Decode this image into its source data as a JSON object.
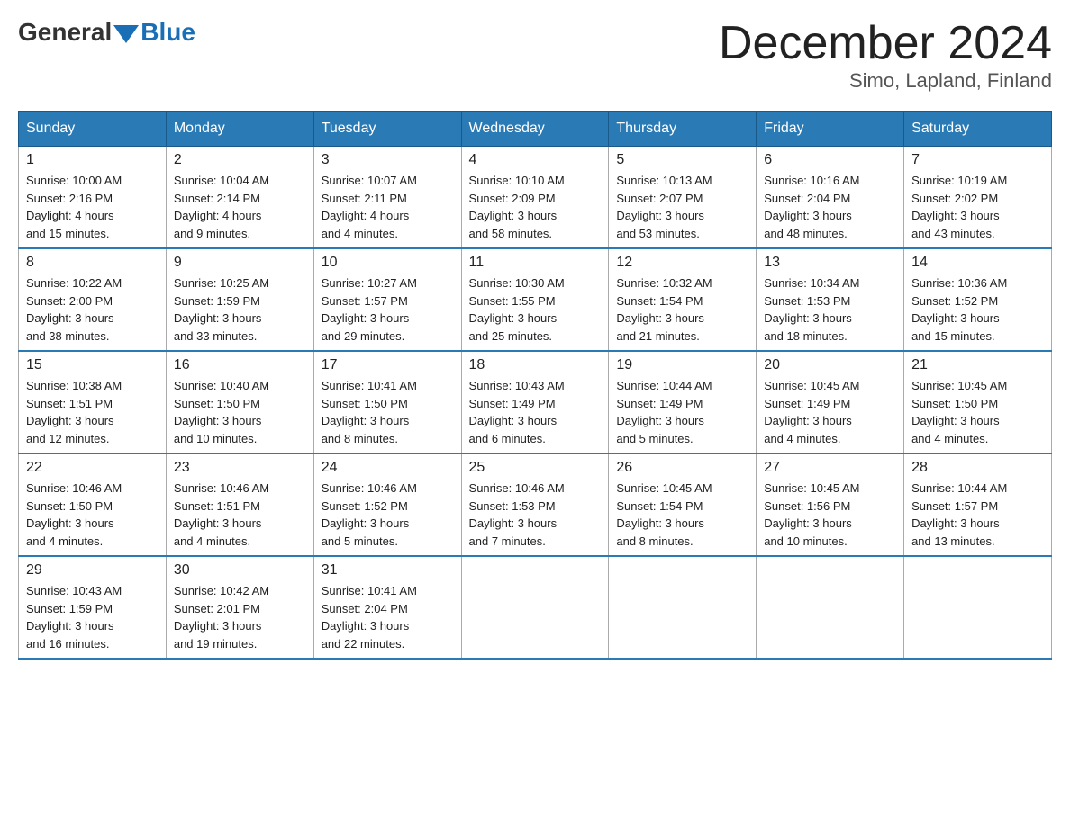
{
  "header": {
    "logo_general": "General",
    "logo_blue": "Blue",
    "month_title": "December 2024",
    "location": "Simo, Lapland, Finland"
  },
  "days_of_week": [
    "Sunday",
    "Monday",
    "Tuesday",
    "Wednesday",
    "Thursday",
    "Friday",
    "Saturday"
  ],
  "weeks": [
    [
      {
        "day": "1",
        "sunrise": "10:00 AM",
        "sunset": "2:16 PM",
        "daylight": "4 hours and 15 minutes."
      },
      {
        "day": "2",
        "sunrise": "10:04 AM",
        "sunset": "2:14 PM",
        "daylight": "4 hours and 9 minutes."
      },
      {
        "day": "3",
        "sunrise": "10:07 AM",
        "sunset": "2:11 PM",
        "daylight": "4 hours and 4 minutes."
      },
      {
        "day": "4",
        "sunrise": "10:10 AM",
        "sunset": "2:09 PM",
        "daylight": "3 hours and 58 minutes."
      },
      {
        "day": "5",
        "sunrise": "10:13 AM",
        "sunset": "2:07 PM",
        "daylight": "3 hours and 53 minutes."
      },
      {
        "day": "6",
        "sunrise": "10:16 AM",
        "sunset": "2:04 PM",
        "daylight": "3 hours and 48 minutes."
      },
      {
        "day": "7",
        "sunrise": "10:19 AM",
        "sunset": "2:02 PM",
        "daylight": "3 hours and 43 minutes."
      }
    ],
    [
      {
        "day": "8",
        "sunrise": "10:22 AM",
        "sunset": "2:00 PM",
        "daylight": "3 hours and 38 minutes."
      },
      {
        "day": "9",
        "sunrise": "10:25 AM",
        "sunset": "1:59 PM",
        "daylight": "3 hours and 33 minutes."
      },
      {
        "day": "10",
        "sunrise": "10:27 AM",
        "sunset": "1:57 PM",
        "daylight": "3 hours and 29 minutes."
      },
      {
        "day": "11",
        "sunrise": "10:30 AM",
        "sunset": "1:55 PM",
        "daylight": "3 hours and 25 minutes."
      },
      {
        "day": "12",
        "sunrise": "10:32 AM",
        "sunset": "1:54 PM",
        "daylight": "3 hours and 21 minutes."
      },
      {
        "day": "13",
        "sunrise": "10:34 AM",
        "sunset": "1:53 PM",
        "daylight": "3 hours and 18 minutes."
      },
      {
        "day": "14",
        "sunrise": "10:36 AM",
        "sunset": "1:52 PM",
        "daylight": "3 hours and 15 minutes."
      }
    ],
    [
      {
        "day": "15",
        "sunrise": "10:38 AM",
        "sunset": "1:51 PM",
        "daylight": "3 hours and 12 minutes."
      },
      {
        "day": "16",
        "sunrise": "10:40 AM",
        "sunset": "1:50 PM",
        "daylight": "3 hours and 10 minutes."
      },
      {
        "day": "17",
        "sunrise": "10:41 AM",
        "sunset": "1:50 PM",
        "daylight": "3 hours and 8 minutes."
      },
      {
        "day": "18",
        "sunrise": "10:43 AM",
        "sunset": "1:49 PM",
        "daylight": "3 hours and 6 minutes."
      },
      {
        "day": "19",
        "sunrise": "10:44 AM",
        "sunset": "1:49 PM",
        "daylight": "3 hours and 5 minutes."
      },
      {
        "day": "20",
        "sunrise": "10:45 AM",
        "sunset": "1:49 PM",
        "daylight": "3 hours and 4 minutes."
      },
      {
        "day": "21",
        "sunrise": "10:45 AM",
        "sunset": "1:50 PM",
        "daylight": "3 hours and 4 minutes."
      }
    ],
    [
      {
        "day": "22",
        "sunrise": "10:46 AM",
        "sunset": "1:50 PM",
        "daylight": "3 hours and 4 minutes."
      },
      {
        "day": "23",
        "sunrise": "10:46 AM",
        "sunset": "1:51 PM",
        "daylight": "3 hours and 4 minutes."
      },
      {
        "day": "24",
        "sunrise": "10:46 AM",
        "sunset": "1:52 PM",
        "daylight": "3 hours and 5 minutes."
      },
      {
        "day": "25",
        "sunrise": "10:46 AM",
        "sunset": "1:53 PM",
        "daylight": "3 hours and 7 minutes."
      },
      {
        "day": "26",
        "sunrise": "10:45 AM",
        "sunset": "1:54 PM",
        "daylight": "3 hours and 8 minutes."
      },
      {
        "day": "27",
        "sunrise": "10:45 AM",
        "sunset": "1:56 PM",
        "daylight": "3 hours and 10 minutes."
      },
      {
        "day": "28",
        "sunrise": "10:44 AM",
        "sunset": "1:57 PM",
        "daylight": "3 hours and 13 minutes."
      }
    ],
    [
      {
        "day": "29",
        "sunrise": "10:43 AM",
        "sunset": "1:59 PM",
        "daylight": "3 hours and 16 minutes."
      },
      {
        "day": "30",
        "sunrise": "10:42 AM",
        "sunset": "2:01 PM",
        "daylight": "3 hours and 19 minutes."
      },
      {
        "day": "31",
        "sunrise": "10:41 AM",
        "sunset": "2:04 PM",
        "daylight": "3 hours and 22 minutes."
      },
      null,
      null,
      null,
      null
    ]
  ],
  "labels": {
    "sunrise": "Sunrise:",
    "sunset": "Sunset:",
    "daylight": "Daylight:"
  }
}
